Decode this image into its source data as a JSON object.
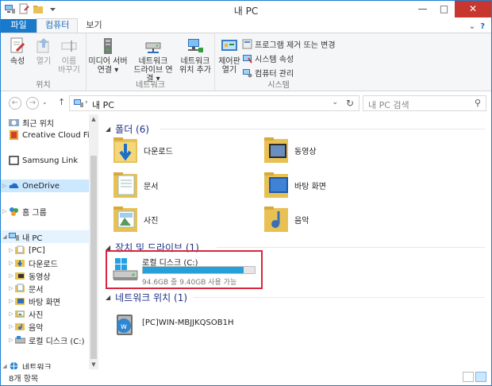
{
  "window": {
    "title": "내 PC",
    "minimize": "—",
    "maximize": "□",
    "close": "✕"
  },
  "ribbon": {
    "tabs": [
      "파일",
      "컴퓨터",
      "보기"
    ],
    "help": "?",
    "groups": {
      "location": {
        "label": "위치",
        "properties": "속성",
        "open": "열기",
        "rename_l1": "이름",
        "rename_l2": "바꾸기"
      },
      "network": {
        "label": "네트워크",
        "media_l1": "미디어 서버",
        "media_l2": "연결 ▾",
        "drive_l1": "네트워크",
        "drive_l2": "드라이브 연결 ▾",
        "add_l1": "네트워크",
        "add_l2": "위치 추가"
      },
      "system": {
        "label": "시스템",
        "control_l1": "제어판",
        "control_l2": "열기",
        "uninstall": "프로그램 제거 또는 변경",
        "sysprops": "시스템 속성",
        "manage": "컴퓨터 관리"
      }
    }
  },
  "address": {
    "path": "내 PC",
    "search_placeholder": "내 PC 검색"
  },
  "nav": {
    "items": [
      {
        "label": "최근 위치"
      },
      {
        "label": "Creative Cloud Fi"
      },
      {
        "label": "Samsung Link"
      },
      {
        "label": "OneDrive"
      },
      {
        "label": "홈 그룹"
      },
      {
        "label": "내 PC"
      },
      {
        "label": "[PC]"
      },
      {
        "label": "다운로드"
      },
      {
        "label": "동영상"
      },
      {
        "label": "문서"
      },
      {
        "label": "바탕 화면"
      },
      {
        "label": "사진"
      },
      {
        "label": "음악"
      },
      {
        "label": "로컬 디스크 (C:)"
      },
      {
        "label": "네트워크"
      }
    ]
  },
  "content": {
    "folders_header": "폴더 (6)",
    "folders": [
      {
        "label": "다운로드"
      },
      {
        "label": "동영상"
      },
      {
        "label": "문서"
      },
      {
        "label": "바탕 화면"
      },
      {
        "label": "사진"
      },
      {
        "label": "음악"
      }
    ],
    "devices_header": "장치 및 드라이브 (1)",
    "drive": {
      "label": "로컬 디스크 (C:)",
      "free_text": "94.6GB 중 9.40GB 사용 가능",
      "used_fraction": 0.9
    },
    "network_header": "네트워크 위치 (1)",
    "network_location": {
      "label": "[PC]WIN-MBJJKQSOB1H"
    }
  },
  "status": {
    "item_count": "8개 항목"
  },
  "colors": {
    "accent": "#1979ca",
    "selection": "#cce8ff",
    "drive_bar": "#26a0da",
    "highlight_box": "#d7263d",
    "group_header": "#1e3287"
  }
}
